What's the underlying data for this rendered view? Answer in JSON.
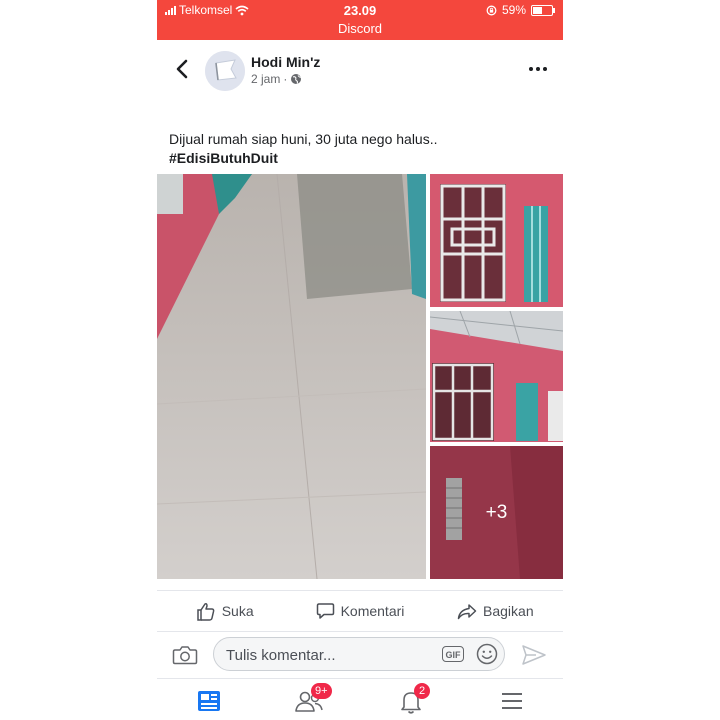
{
  "status_bar": {
    "carrier": "Telkomsel",
    "time": "23.09",
    "app": "Discord",
    "battery": "59%",
    "battery_level": 0.59,
    "bar_color": "#f4473d"
  },
  "post": {
    "author": "Hodi Min'z",
    "time": "2 jam",
    "audience_icon": "globe-icon",
    "text_line": "Dijual rumah siap huni, 30 juta nego halus..",
    "hashtag": "#EdisiButuhDuit",
    "more_photos": "+3"
  },
  "actions": {
    "like": "Suka",
    "comment": "Komentari",
    "share": "Bagikan"
  },
  "comment_bar": {
    "placeholder": "Tulis komentar...",
    "gif": "GIF"
  },
  "bottom_nav": {
    "friends_badge": "9+",
    "notifications_badge": "2",
    "accent": "#1877f2"
  }
}
